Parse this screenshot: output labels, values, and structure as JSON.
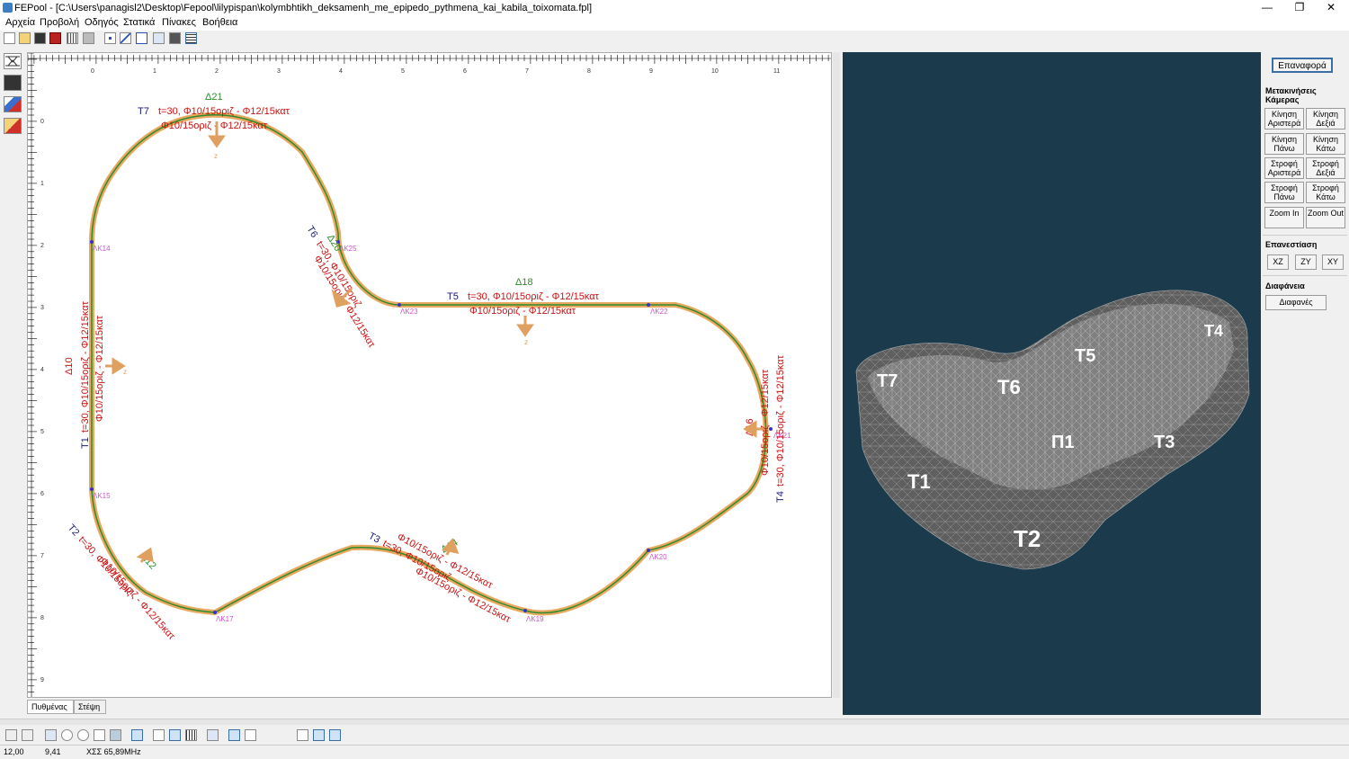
{
  "app": {
    "title": "FEPool - [C:\\Users\\panagisl2\\Desktop\\Fepool\\lilypispan\\kolymbhtikh_deksamenh_me_epipedo_pythmena_kai_kabila_toixomata.fpl]",
    "window_controls": [
      "—",
      "❐",
      "✕"
    ]
  },
  "menu": [
    "Αρχεία",
    "Προβολή",
    "Οδηγός",
    "Στατικά",
    "Πίνακες",
    "Βοήθεια"
  ],
  "icons": {
    "toolbar": [
      "new-file-icon",
      "open-folder-icon",
      "save-icon",
      "material-icon",
      "grid-icon",
      "print-icon",
      "node-icon",
      "line-icon",
      "polyline-icon",
      "frame-icon",
      "calculator-icon",
      "table-icon"
    ],
    "left_tools": [
      "supports-icon",
      "calculator-icon",
      "eraser-icon",
      "delete-loads-icon"
    ]
  },
  "drawing": {
    "ruler_top_labels": [
      "0",
      "1",
      "2",
      "3",
      "4",
      "5",
      "6",
      "7",
      "8",
      "9",
      "10",
      "11"
    ],
    "ruler_left_labels": [
      "0",
      "1",
      "2",
      "3",
      "4",
      "5",
      "6",
      "7",
      "8",
      "9"
    ],
    "nodes": [
      "ΛΚ14",
      "ΛΚ15",
      "ΛΚ17",
      "ΛΚ19",
      "ΛΚ20",
      "ΛΚ21",
      "ΛΚ22",
      "ΛΚ23",
      "ΛΚ25"
    ],
    "walls": {
      "T7": {
        "name": "T7",
        "spec": "t=30, Φ10/15οριζ - Φ12/15κατ",
        "second": "Φ10/15οριζ - Φ12/15κατ",
        "load": "Δ21"
      },
      "T6": {
        "name": "T6",
        "spec": "t=30, Φ10/15οριζ",
        "second": "Φ10/15οριζ - Φ12/15κατ",
        "load": "Δ20"
      },
      "T5": {
        "name": "T5",
        "spec": "t=30, Φ10/15οριζ - Φ12/15κατ",
        "second": "Φ10/15οριζ - Φ12/15κατ",
        "load": "Δ18"
      },
      "T1": {
        "name": "T1",
        "spec": "t=30, Φ10/15οριζ - Φ12/15κατ",
        "second": "Φ10/15οριζ - Φ12/15κατ",
        "load": "Δ10"
      },
      "T4": {
        "name": "T4",
        "spec": "t=30, Φ10/15οριζ - Φ12/15κατ",
        "second": "Φ10/15οριζ - Φ12/15κατ",
        "load": "Δ16"
      },
      "T2": {
        "name": "T2",
        "spec": "t=30, Φ10/15οριζ",
        "second": "Φ10/15οριζ - Φ12/15κατ",
        "load": "Δ12"
      },
      "T3": {
        "name": "T3",
        "spec": "t=30, Φ10/15οριζ",
        "second": "Φ10/15οριζ - Φ12/15κατ",
        "load": "Δ14"
      }
    },
    "axis_label": "z"
  },
  "view3d": {
    "labels": [
      "T7",
      "T6",
      "T5",
      "T4",
      "T3",
      "T2",
      "T1",
      "Π1"
    ]
  },
  "right_panel": {
    "reset": "Επαναφορά",
    "camera_heading": "Μετακινήσεις Κάμερας",
    "camera_buttons": [
      [
        "Κίνηση Αριστερά",
        "Κίνηση Δεξιά"
      ],
      [
        "Κίνηση Πάνω",
        "Κίνηση Κάτω"
      ],
      [
        "Στροφή Αριστερά",
        "Στροφή Δεξιά"
      ],
      [
        "Στροφή Πάνω",
        "Στροφή Κάτω"
      ],
      [
        "Zoom In",
        "Zoom Out"
      ]
    ],
    "plane_heading": "Επανεστίαση",
    "planes": [
      "XZ",
      "ZY",
      "XY"
    ],
    "transparency_heading": "Διαφάνεια",
    "transparency_button": "Διαφανές"
  },
  "tabs": [
    "Πυθμένας",
    "Στέψη"
  ],
  "status": {
    "x": "12,00",
    "y": "9,41",
    "clock": "ΧΣΣ 65,89MHz"
  },
  "colors": {
    "wall_fill": "#e9a85f",
    "wall_line": "#2e8b2e",
    "label_red": "#cc1111",
    "label_blue": "#1a1a7a",
    "load": "#e0a060",
    "node": "#3333cc",
    "bg3d": "#1b3b4d"
  }
}
